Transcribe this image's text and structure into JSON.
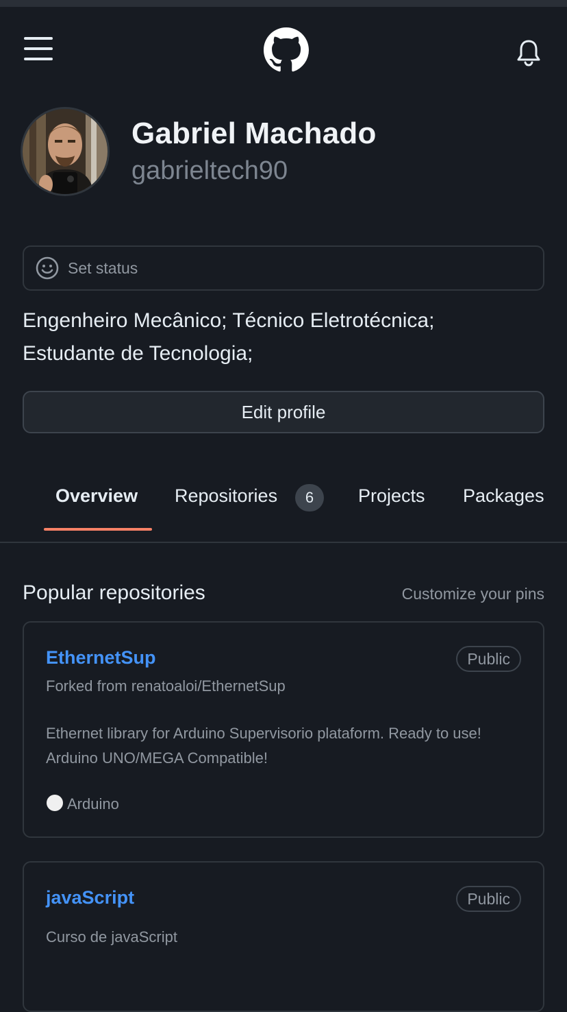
{
  "header": {
    "menu_icon": "hamburger-menu-icon",
    "logo_icon": "github-logo-icon",
    "notification_icon": "bell-icon"
  },
  "profile": {
    "name": "Gabriel Machado",
    "login": "gabrieltech90",
    "avatar": "avatar-photo",
    "status_placeholder": "Set status",
    "bio_line1": "Engenheiro Mecânico; Técnico Eletrotécnica;",
    "bio_line2": "Estudante de Tecnologia;",
    "edit_label": "Edit profile"
  },
  "tabs": [
    {
      "label": "Overview",
      "active": true
    },
    {
      "label": "Repositories",
      "count": "6"
    },
    {
      "label": "Projects"
    },
    {
      "label": "Packages"
    }
  ],
  "popular": {
    "title": "Popular repositories",
    "customize_label": "Customize your pins",
    "repos": [
      {
        "name": "EthernetSup",
        "visibility": "Public",
        "forked_from": "Forked from renatoaloi/EthernetSup",
        "description": "Ethernet library for Arduino Supervisorio plataform. Ready to use! Arduino UNO/MEGA Compatible!",
        "language": "Arduino",
        "language_color": "#f0f0f0"
      },
      {
        "name": "javaScript",
        "visibility": "Public",
        "description": "Curso de javaScript"
      }
    ]
  },
  "colors": {
    "background": "#171b22",
    "link": "#4493f8",
    "tab_underline": "#f78166",
    "muted_text": "#9198a1"
  }
}
